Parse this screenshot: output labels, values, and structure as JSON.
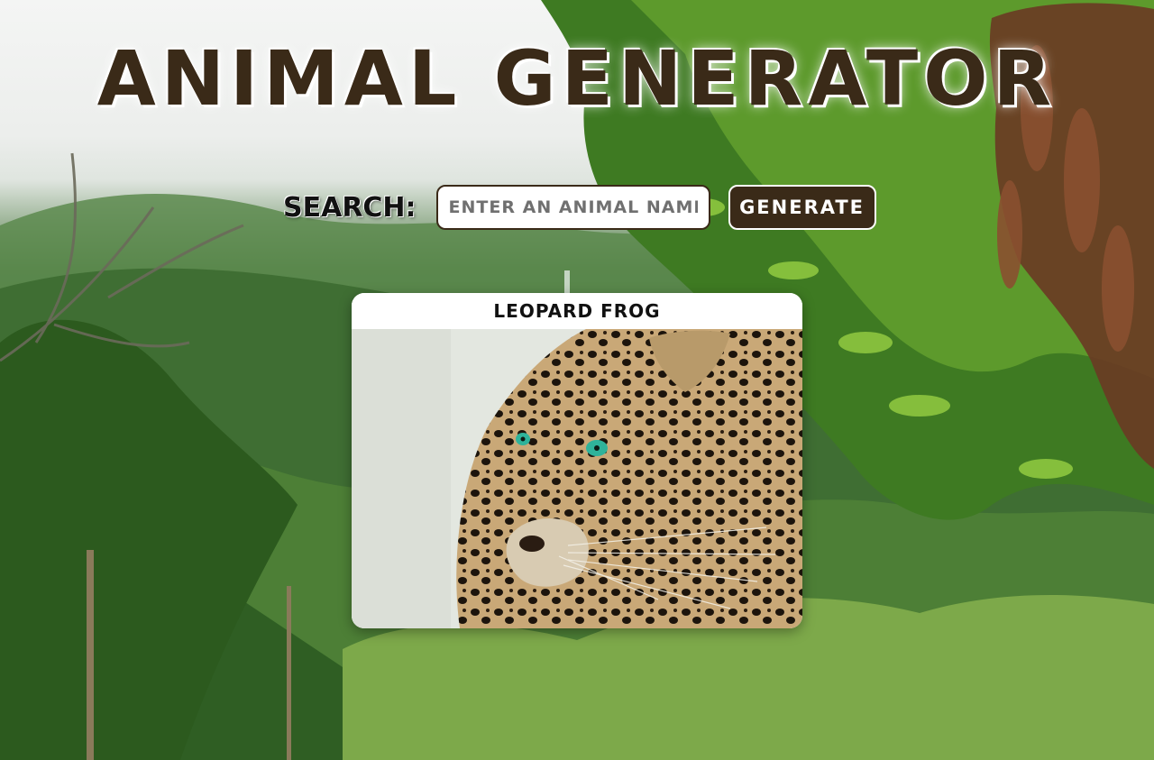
{
  "header": {
    "title": "ANIMAL GENERATOR"
  },
  "search": {
    "label": "SEARCH:",
    "placeholder": "ENTER AN ANIMAL NAME",
    "value": "",
    "button_label": "GENERATE"
  },
  "result": {
    "name": "LEOPARD FROG",
    "image_subject": "leopard"
  },
  "colors": {
    "brand_brown": "#3a2a18",
    "card_bg": "#ffffff"
  }
}
